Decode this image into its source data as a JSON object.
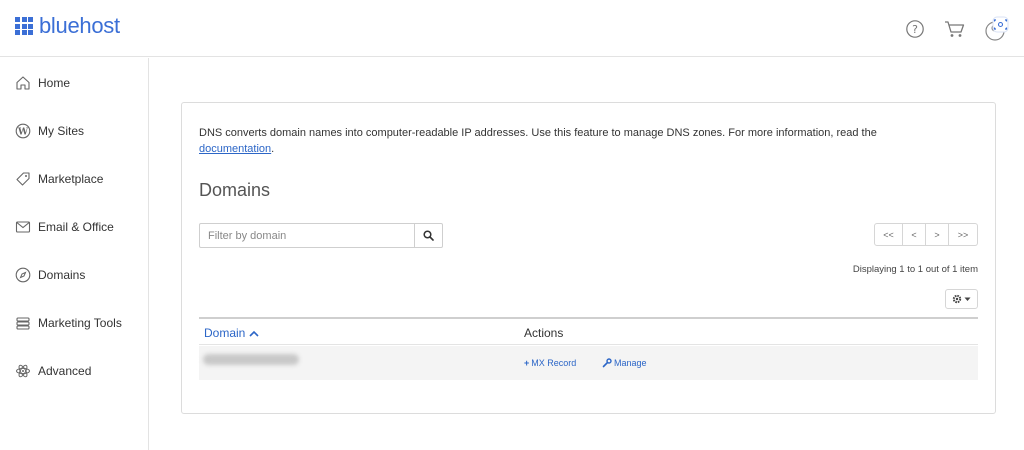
{
  "brand": {
    "name": "bluehost",
    "color": "#3b6fd6"
  },
  "header": {
    "icons": [
      "help-icon",
      "cart-icon",
      "avatar-icon"
    ]
  },
  "sidebar": {
    "items": [
      {
        "label": "Home",
        "icon": "home-icon"
      },
      {
        "label": "My Sites",
        "icon": "wordpress-icon"
      },
      {
        "label": "Marketplace",
        "icon": "tag-icon"
      },
      {
        "label": "Email & Office",
        "icon": "mail-icon"
      },
      {
        "label": "Domains",
        "icon": "compass-icon"
      },
      {
        "label": "Marketing Tools",
        "icon": "marketing-icon"
      },
      {
        "label": "Advanced",
        "icon": "atom-icon"
      }
    ]
  },
  "main": {
    "description": "DNS converts domain names into computer-readable IP addresses. Use this feature to manage DNS zones. For more information, read the",
    "doc_link": "documentation",
    "doc_suffix": ".",
    "title": "Domains",
    "filter": {
      "placeholder": "Filter by domain"
    },
    "pager": {
      "first": "<<",
      "prev": "<",
      "next": ">",
      "last": ">>"
    },
    "displaying": "Displaying 1 to 1 out of 1 item",
    "table": {
      "columns": {
        "domain": "Domain",
        "actions": "Actions"
      },
      "rows": [
        {
          "mx_record": "MX Record",
          "manage": "Manage"
        }
      ]
    }
  },
  "colors": {
    "link": "#2c66c7",
    "border": "#dcdcdc",
    "row_bg": "#f4f4f4"
  }
}
